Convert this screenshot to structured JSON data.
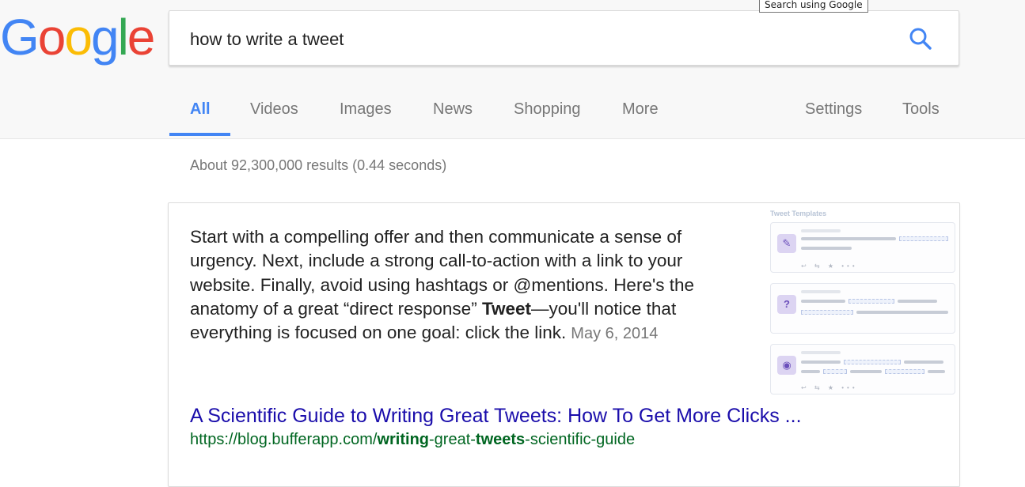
{
  "logo": {
    "letters": [
      "G",
      "o",
      "o",
      "g",
      "l",
      "e"
    ],
    "colors": [
      "#4285f4",
      "#ea4335",
      "#fbbc05",
      "#4285f4",
      "#34a853",
      "#ea4335"
    ]
  },
  "search": {
    "query": "how to write a tweet",
    "button_icon": "search-icon",
    "tooltip": "Search using Google"
  },
  "tabs": [
    {
      "label": "All",
      "active": true
    },
    {
      "label": "Videos"
    },
    {
      "label": "Images"
    },
    {
      "label": "News"
    },
    {
      "label": "Shopping"
    },
    {
      "label": "More"
    },
    {
      "label": "Settings"
    },
    {
      "label": "Tools"
    }
  ],
  "stats": "About 92,300,000 results (0.44 seconds)",
  "featured": {
    "snippet_before": "Start with a compelling offer and then communicate a sense of urgency. Next, include a strong call-to-action with a link to your website. Finally, avoid using hashtags or @mentions. Here's the anatomy of a great “direct response” ",
    "snippet_bold": "Tweet",
    "snippet_after": "—you'll notice that everything is focused on one goal: click the link.",
    "date": "May 6, 2014",
    "title": "A Scientific Guide to Writing Great Tweets: How To Get More Clicks ...",
    "url_parts": [
      {
        "text": "https://blog.bufferapp.com/",
        "bold": false
      },
      {
        "text": "writing",
        "bold": true
      },
      {
        "text": "-great-",
        "bold": false
      },
      {
        "text": "tweets",
        "bold": true
      },
      {
        "text": "-scientific-guide",
        "bold": false
      }
    ],
    "thumbnail": {
      "heading": "Tweet Templates",
      "cards": [
        {
          "icon": "pencil-icon",
          "glyph": "✎"
        },
        {
          "icon": "question-icon",
          "glyph": "?"
        },
        {
          "icon": "lightbulb-icon",
          "glyph": "◉"
        }
      ]
    }
  },
  "colors": {
    "link": "#1a0dab",
    "url": "#006621",
    "accent": "#4285f4",
    "muted": "#777777"
  }
}
